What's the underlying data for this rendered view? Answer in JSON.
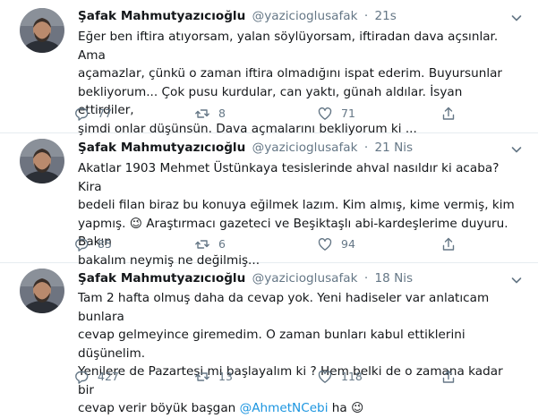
{
  "tweets": [
    {
      "author": "Şafak Mahmutyazıcıoğlu",
      "handle": "@yazicioglusafak",
      "sep": "·",
      "time": "21s",
      "text": "Eğer ben iftira atıyorsam, yalan söylüyorsam, iftiradan dava açsınlar. Ama\naçamazlar, çünkü o zaman iftira olmadığını ispat ederim. Buyursunlar\nbekliyorum... Çok pusu kurdular, can yaktı, günah aldılar. İsyan ettirdiler,\nşimdi onlar düşünsün. Dava açmalarını bekliyorum ki ...",
      "replies": "77",
      "retweets": "8",
      "likes": "71"
    },
    {
      "author": "Şafak Mahmutyazıcıoğlu",
      "handle": "@yazicioglusafak",
      "sep": "·",
      "time": "21 Nis",
      "text_a": "Akatlar 1903 Mehmet Üstünkaya tesislerinde ahval nasıldır ki acaba? Kira\nbedeli filan biraz bu konuya eğilmek lazım. Kim almış, kime vermiş, kim\nyapmış. ",
      "emoji": "😉",
      "text_b": " Araştırmacı gazeteci ve Beşiktaşlı abi-kardeşlerime duyuru. Bakın\nbakalım neymiş ne değilmiş...",
      "replies": "85",
      "retweets": "6",
      "likes": "94"
    },
    {
      "author": "Şafak Mahmutyazıcıoğlu",
      "handle": "@yazicioglusafak",
      "sep": "·",
      "time": "18 Nis",
      "text_a": "Tam 2 hafta olmuş daha da cevap yok. Yeni hadiseler var anlatıcam bunlara\ncevap gelmeyince giremedim. O zaman bunları kabul ettiklerini düşünelim.\nYenilere de Pazartesi mi başlayalım ki ? Hem belki de o zamana kadar bir\ncevap verir böyük başgan ",
      "mention": "@AhmetNCebi",
      "text_b": "  ha ",
      "emoji": "😉",
      "replies": "427",
      "retweets": "13",
      "likes": "118"
    }
  ],
  "icons": {
    "reply": "reply-icon",
    "retweet": "retweet-icon",
    "like": "heart-icon",
    "share": "share-icon",
    "caret": "chevron-down-icon"
  },
  "colors": {
    "text": "#14171a",
    "muted": "#657786",
    "link": "#1b95e0",
    "divider": "#e6ecf0"
  }
}
